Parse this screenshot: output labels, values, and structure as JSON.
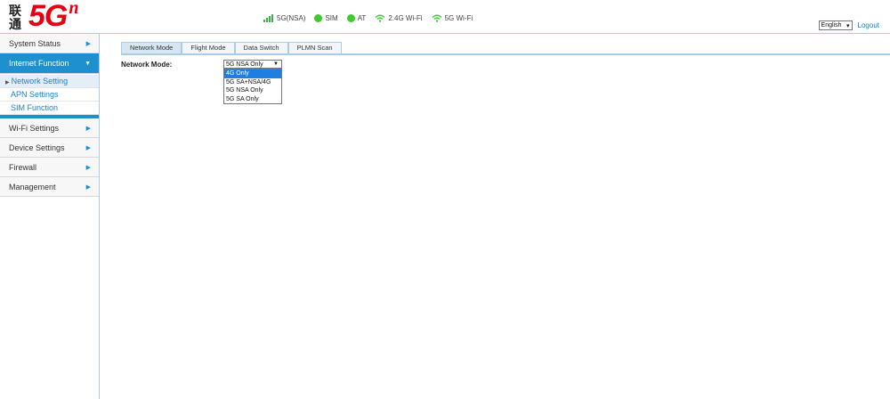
{
  "logo": {
    "cn_line1": "联",
    "cn_line2": "通",
    "main": "5G",
    "sup": "n"
  },
  "status": {
    "signal": {
      "label": "5G(NSA)",
      "color": "#3bb34a"
    },
    "sim": {
      "label": "SIM",
      "color": "#3ecb2e"
    },
    "at": {
      "label": "AT",
      "color": "#3ecb2e"
    },
    "wifi24": {
      "label": "2.4G Wi-Fi",
      "color": "#3ecb2e"
    },
    "wifi5": {
      "label": "5G Wi-Fi",
      "color": "#3ecb2e"
    }
  },
  "language": {
    "selected": "English"
  },
  "logout_label": "Logout",
  "sidebar": {
    "items": [
      {
        "label": "System Status"
      },
      {
        "label": "Internet Function"
      },
      {
        "label": "Wi-Fi Settings"
      },
      {
        "label": "Device Settings"
      },
      {
        "label": "Firewall"
      },
      {
        "label": "Management"
      }
    ],
    "submenu": [
      {
        "label": "Network Setting"
      },
      {
        "label": "APN Settings"
      },
      {
        "label": "SIM Function"
      }
    ]
  },
  "tabs": [
    {
      "label": "Network Mode"
    },
    {
      "label": "Flight Mode"
    },
    {
      "label": "Data Switch"
    },
    {
      "label": "PLMN Scan"
    }
  ],
  "network_mode": {
    "label": "Network Mode:",
    "selected": "5G NSA Only",
    "options": [
      "4G Only",
      "5G SA+NSA/4G",
      "5G NSA Only",
      "5G SA Only"
    ],
    "highlighted_index": 0
  },
  "colors": {
    "accent": "#1e90cf",
    "link": "#1a7fc8",
    "brand": "#e60012"
  }
}
